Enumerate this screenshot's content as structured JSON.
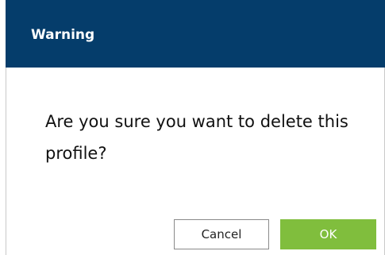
{
  "dialog": {
    "title": "Warning",
    "message": "Are you sure you want to delete this profile?",
    "buttons": {
      "cancel": "Cancel",
      "ok": "OK"
    }
  },
  "colors": {
    "header_background": "#053d6b",
    "header_text": "#ffffff",
    "ok_button": "#80be3d",
    "cancel_border": "#8a8a8a"
  }
}
